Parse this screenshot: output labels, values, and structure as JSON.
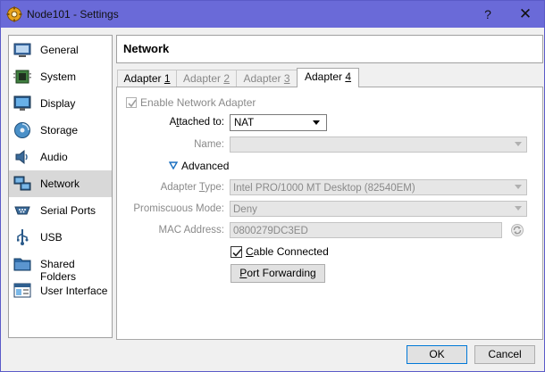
{
  "window": {
    "title": "Node101 - Settings",
    "help_label": "?",
    "close_label": "✕"
  },
  "sidebar": {
    "items": [
      {
        "label": "General",
        "icon": "general-icon"
      },
      {
        "label": "System",
        "icon": "system-icon"
      },
      {
        "label": "Display",
        "icon": "display-icon"
      },
      {
        "label": "Storage",
        "icon": "storage-icon"
      },
      {
        "label": "Audio",
        "icon": "audio-icon"
      },
      {
        "label": "Network",
        "icon": "network-icon",
        "selected": true
      },
      {
        "label": "Serial Ports",
        "icon": "serial-ports-icon"
      },
      {
        "label": "USB",
        "icon": "usb-icon"
      },
      {
        "label": "Shared Folders",
        "icon": "shared-folders-icon"
      },
      {
        "label": "User Interface",
        "icon": "user-interface-icon"
      }
    ]
  },
  "panel": {
    "heading": "Network",
    "tabs": [
      {
        "pre": "Adapter ",
        "ul": "1"
      },
      {
        "pre": "Adapter ",
        "ul": "2"
      },
      {
        "pre": "Adapter ",
        "ul": "3"
      },
      {
        "pre": "Adapter ",
        "ul": "4",
        "active": true
      }
    ]
  },
  "form": {
    "enable_adapter": {
      "label": "Enable Network Adapter",
      "checked": true
    },
    "attached_to": {
      "pre": "A",
      "ul": "t",
      "post": "tached to:",
      "value": "NAT"
    },
    "name": {
      "label": "Name:",
      "value": ""
    },
    "advanced": {
      "label": "Advanced"
    },
    "adapter_type": {
      "pre": "Adapter ",
      "ul": "T",
      "post": "ype:",
      "value": "Intel PRO/1000 MT Desktop (82540EM)"
    },
    "promiscuous": {
      "pre": "Promiscuous Mode:",
      "value": "Deny"
    },
    "mac": {
      "label": "MAC Address:",
      "value": "0800279DC3ED"
    },
    "cable": {
      "ul": "C",
      "post": "able Connected",
      "checked": true
    },
    "port_forwarding": {
      "ul": "P",
      "post": "ort Forwarding"
    }
  },
  "footer": {
    "ok_label": "OK",
    "cancel_label": "Cancel"
  },
  "colors": {
    "titlebar": "#6a6ad8",
    "accent": "#0078d7",
    "selected": "#d8d8d8"
  }
}
